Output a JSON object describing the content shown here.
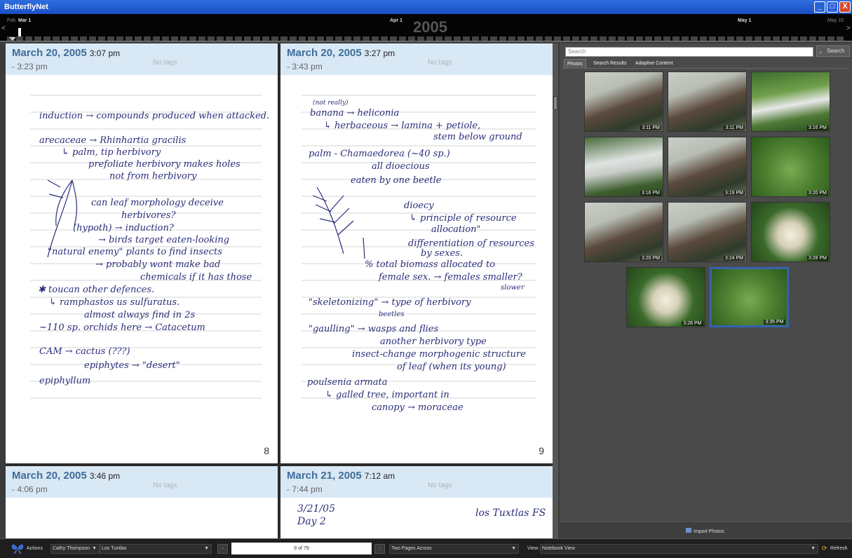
{
  "window": {
    "title": "ButterflyNet",
    "minimize": "_",
    "maximize": "□",
    "close": "X"
  },
  "timeline": {
    "labels": {
      "feb": "Feb",
      "mar1": "Mar 1",
      "apr1": "Apr 1",
      "may1": "May 1",
      "may10": "May 10"
    },
    "year": "2005",
    "left_arrow": "<",
    "right_arrow": ">"
  },
  "pages": [
    {
      "date": "March 20, 2005",
      "start": "3:07 pm",
      "end": "- 3:23 pm",
      "tags": "No tags",
      "number": "8",
      "ink": [
        "induction → compounds produced when attacked.",
        "arecaceae → Rhinhartia gracilis",
        "↳ palm, tip herbivory",
        "prefoliate herbivory makes holes",
        "not from herbivory",
        "can leaf morphology deceive",
        "herbivores?",
        "(hypoth) → induction?",
        "→ birds target eaten-looking",
        "\"natural enemy\" plants to find insects",
        "→ probably wont make bad",
        "chemicals if it has those",
        "✱ toucan     other defences.",
        "↳ ramphastos us sulfuratus.",
        "almost always find in 2s",
        "~110 sp. orchids here → Catacetum",
        "CAM → cactus (???)",
        "epiphytes → \"desert\"",
        "epiphyllum"
      ]
    },
    {
      "date": "March 20, 2005",
      "start": "3:27 pm",
      "end": "- 3:43 pm",
      "tags": "No tags",
      "number": "9",
      "ink": [
        "(not really)",
        "banana → heliconia",
        "↳ herbaceous → lamina + petiole,",
        "stem below ground",
        "palm - Chamaedorea (~40 sp.)",
        "all dioecious",
        "eaten by one beetle",
        "dioecy",
        "↳ principle of resource",
        "allocation\"",
        "differentiation of resources",
        "by sexes.",
        "% total biomass allocated to",
        "female sex. → females smaller?",
        "slower",
        "\"skeletonizing\" → type of herbivory",
        "beetles",
        "\"gaulling\" → wasps and flies",
        "another herbivory type",
        "insect-change morphogenic structure",
        "of leaf (when its young)",
        "poulsenia armata",
        "↳ galled tree, important in",
        "canopy → moraceae"
      ]
    },
    {
      "date": "March 20, 2005",
      "start": "3:46 pm",
      "end": "- 4:06 pm",
      "tags": "No tags",
      "ink": []
    },
    {
      "date": "March 21, 2005",
      "start": "7:12 am",
      "end": "- 7:44 pm",
      "tags": "No tags",
      "ink": [
        "3/21/05",
        "Day 2",
        "los Tuxtlas FS"
      ]
    }
  ],
  "photos": {
    "search_placeholder": "Search",
    "search_button": "Search",
    "tabs": [
      "Photos",
      "Search Results",
      "Adaptive Content"
    ],
    "items": [
      {
        "time": "3:11 PM",
        "scene": "people"
      },
      {
        "time": "3:11 PM",
        "scene": "people"
      },
      {
        "time": "3:16 PM",
        "scene": "forest"
      },
      {
        "time": "3:16 PM",
        "scene": "van"
      },
      {
        "time": "3:19 PM",
        "scene": "people"
      },
      {
        "time": "3:20 PM",
        "scene": "leaves"
      },
      {
        "time": "3:20 PM",
        "scene": "people"
      },
      {
        "time": "3:24 PM",
        "scene": "people"
      },
      {
        "time": "3:28 PM",
        "scene": "flowers"
      },
      {
        "time": "3:28 PM",
        "scene": "flowers"
      },
      {
        "time": "3:35 PM",
        "scene": "leaves",
        "selected": true
      }
    ],
    "import_label": "Import Photos"
  },
  "toolbar": {
    "actions": "Actions",
    "user": "Cathy Thompson",
    "notebook": "Los Tuxtlas",
    "page": "8 of 79",
    "layout": "Two Pages Across",
    "view_label": "View:",
    "view": "Notebook View",
    "refresh": "Refresh"
  }
}
